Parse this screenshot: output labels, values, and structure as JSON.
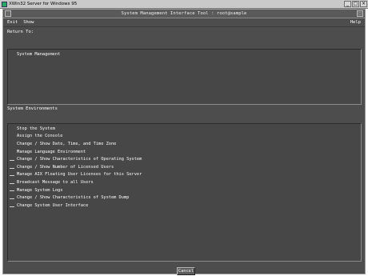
{
  "host": {
    "title": "XWin32 Server for Windows 95",
    "min": "_",
    "max": "□",
    "close": "×"
  },
  "window": {
    "title": "System Management Interface Tool : root@sample",
    "maximize": "□"
  },
  "menu": {
    "exit": "Exit",
    "show": "Show",
    "help": "Help"
  },
  "return_to": {
    "label": "Return To:",
    "items": [
      "System Management"
    ]
  },
  "environments": {
    "label": "System Environments",
    "items": [
      "Stop the System",
      "Assign the Console",
      "Change / Show Date, Time, and Time Zone",
      "Manage Language Environment",
      "Change / Show Characteristics of Operating System",
      "Change / Show Number of Licensed Users",
      "Manage AIX Floating User Licenses for this Server",
      "Broadcast Message to all Users",
      "Manage System Logs",
      "Change / Show Characteristics of System Dump",
      "Change System User Interface"
    ]
  },
  "buttons": {
    "cancel": "Cancel"
  }
}
